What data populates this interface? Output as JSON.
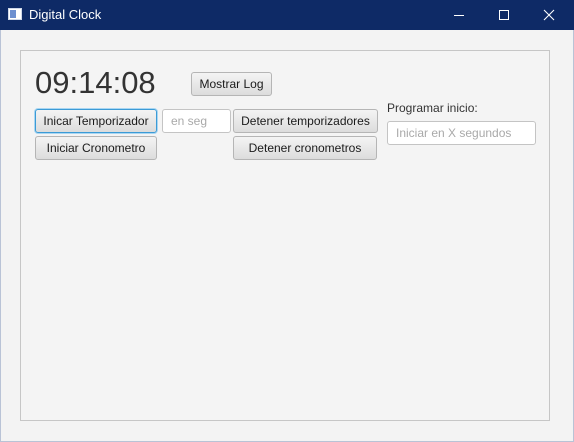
{
  "window": {
    "title": "Digital Clock"
  },
  "clock": {
    "time": "09:14:08"
  },
  "buttons": {
    "show_log": "Mostrar Log",
    "start_timer": "Inicar Temporizador",
    "start_stopwatch": "Iniciar Cronometro",
    "stop_timers": "Detener temporizadores",
    "stop_stopwatches": "Detener cronometros"
  },
  "fields": {
    "seconds_placeholder": "en seg",
    "schedule_label": "Programar inicio:",
    "schedule_placeholder": "Iniciar en X segundos"
  },
  "icons": {
    "app": "app-window-icon",
    "minimize": "minimize-icon",
    "maximize": "maximize-icon",
    "close": "close-icon"
  },
  "colors": {
    "titlebar": "#0e2a66",
    "focus": "#3c9bd6"
  }
}
